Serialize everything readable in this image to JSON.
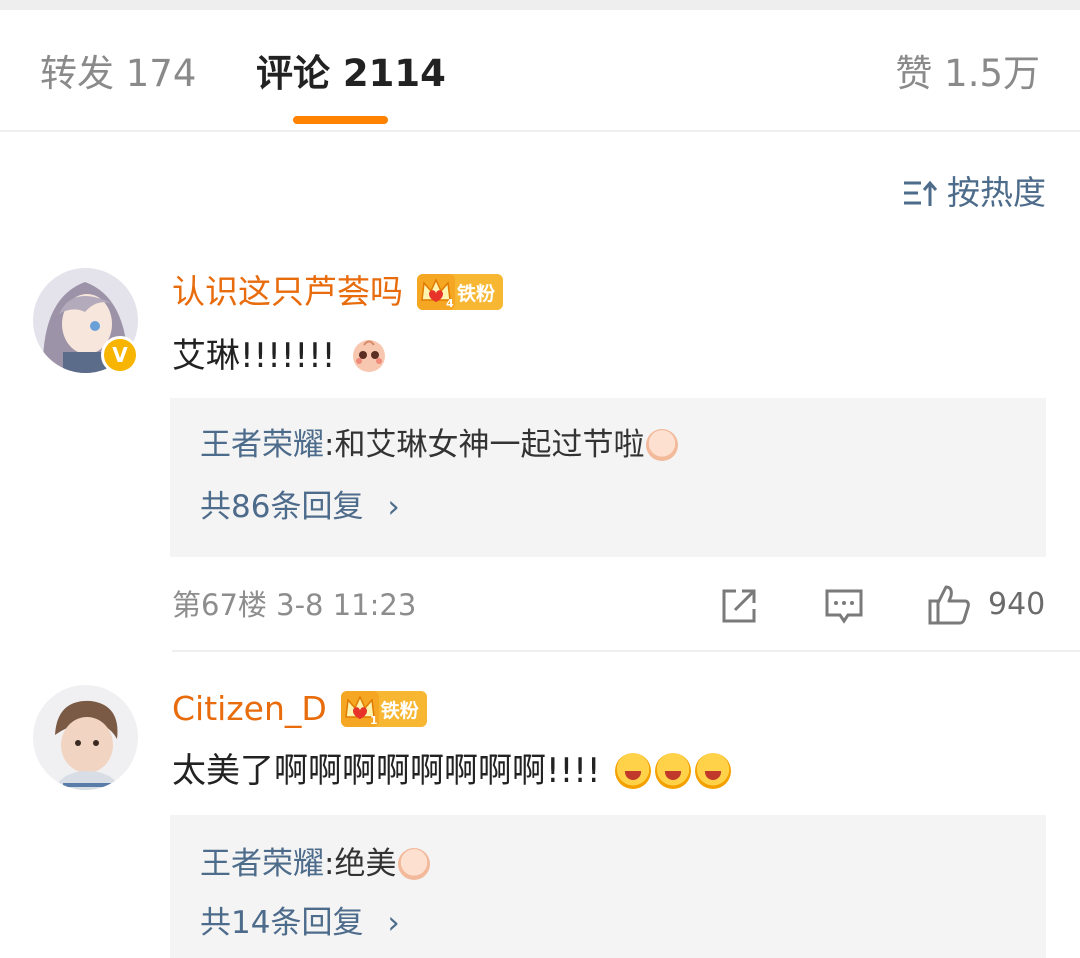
{
  "tabs": {
    "repost": "转发 174",
    "comment": "评论 2114",
    "like": "赞 1.5万"
  },
  "sort": {
    "label": "按热度"
  },
  "comments": [
    {
      "username": "认识这只芦荟吗",
      "fan_badge": "铁粉",
      "fan_level": "4",
      "text": "艾琳!!!!!!!",
      "reply_author": "王者荣耀",
      "reply_sep": ": ",
      "reply_text": "和艾琳女神一起过节啦",
      "reply_more": "共86条回复",
      "floor_time": "第67楼  3-8 11:23",
      "likes": "940"
    },
    {
      "username": "Citizen_D",
      "fan_badge": "铁粉",
      "fan_level": "1",
      "text": "太美了啊啊啊啊啊啊啊啊!!!!",
      "reply_author": "王者荣耀",
      "reply_sep": ": ",
      "reply_text": "绝美",
      "reply_more": "共14条回复"
    }
  ],
  "colors": {
    "accent": "#ff8200",
    "username": "#e86b0c",
    "link": "#4d6b8a"
  }
}
